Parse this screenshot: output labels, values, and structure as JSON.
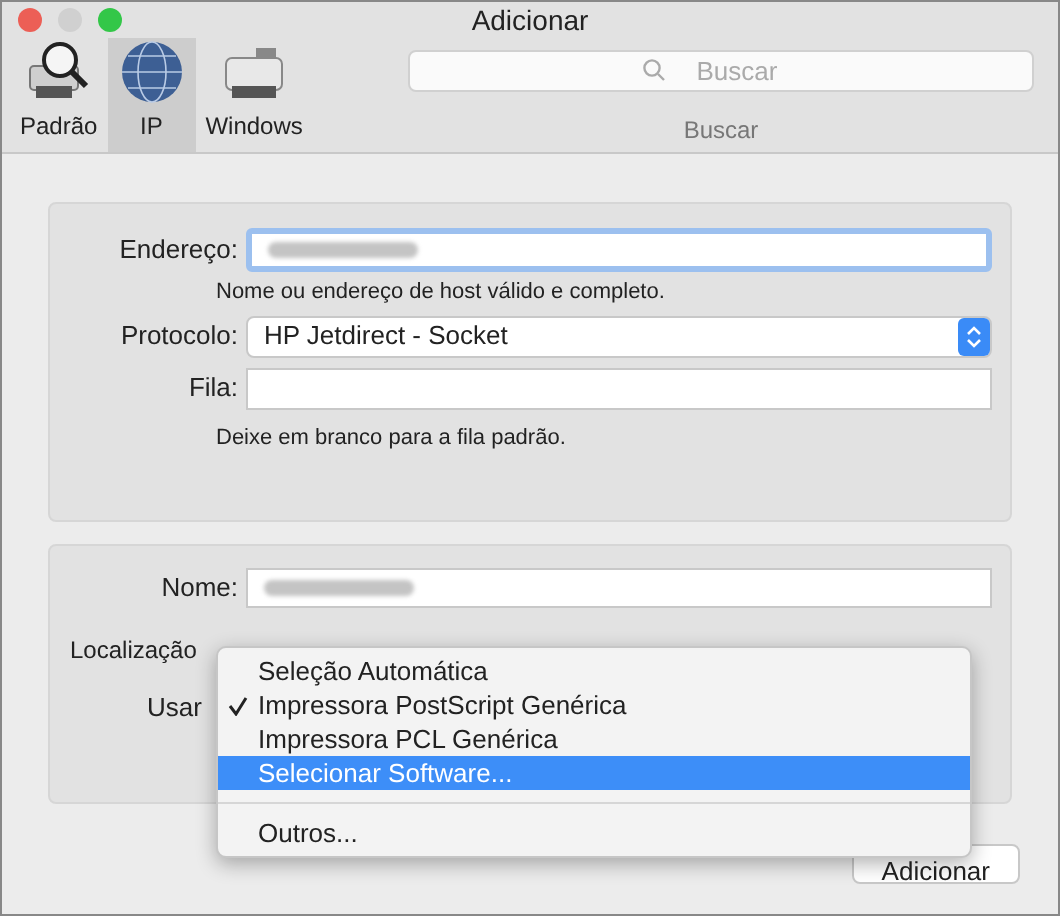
{
  "window": {
    "title": "Adicionar"
  },
  "toolbar": {
    "tabs": [
      {
        "label": "Padrão",
        "selected": false
      },
      {
        "label": "IP",
        "selected": true
      },
      {
        "label": "Windows",
        "selected": false
      }
    ],
    "search": {
      "placeholder": "Buscar",
      "label": "Buscar"
    }
  },
  "connection": {
    "address": {
      "label": "Endereço:",
      "hint": "Nome ou endereço de host válido e completo."
    },
    "protocol": {
      "label": "Protocolo:",
      "value": "HP Jetdirect - Socket"
    },
    "queue": {
      "label": "Fila:",
      "hint": "Deixe em branco para a fila padrão."
    }
  },
  "details": {
    "name": {
      "label": "Nome:"
    },
    "location": {
      "label": "Localização"
    },
    "use": {
      "label": "Usar"
    }
  },
  "menu": [
    {
      "kind": "item",
      "label": "Seleção Automática",
      "checked": false,
      "selected": false
    },
    {
      "kind": "item",
      "label": "Impressora PostScript Genérica",
      "checked": true,
      "selected": false
    },
    {
      "kind": "item",
      "label": "Impressora PCL Genérica",
      "checked": false,
      "selected": false
    },
    {
      "kind": "item",
      "label": "Selecionar Software...",
      "checked": false,
      "selected": true
    },
    {
      "kind": "separator"
    },
    {
      "kind": "item",
      "label": "Outros...",
      "checked": false,
      "selected": false
    }
  ],
  "buttons": [
    {
      "label": "Adicionar"
    }
  ]
}
